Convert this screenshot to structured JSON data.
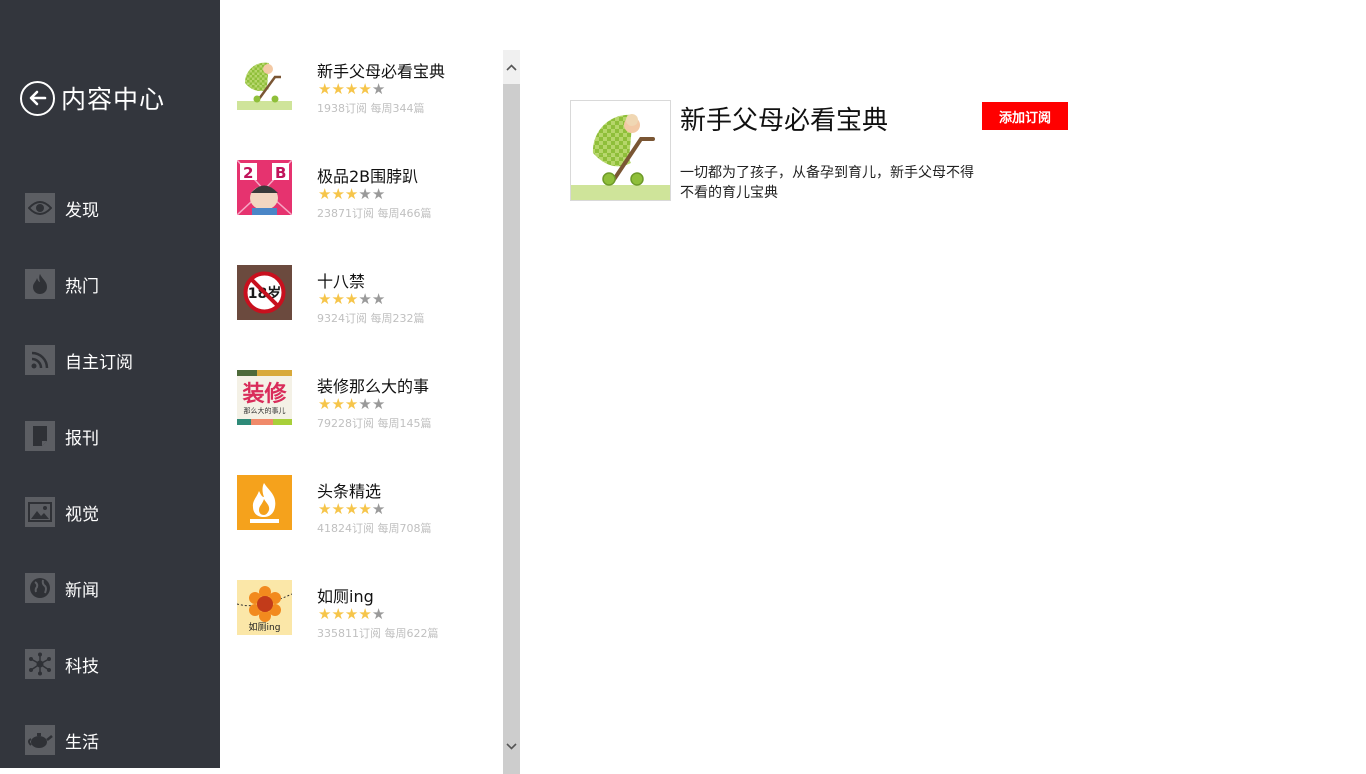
{
  "sidebar": {
    "title": "内容中心",
    "back_icon": "arrow-left-circle-icon",
    "items": [
      {
        "label": "发现",
        "icon": "eye-icon"
      },
      {
        "label": "热门",
        "icon": "flame-icon"
      },
      {
        "label": "自主订阅",
        "icon": "rss-icon"
      },
      {
        "label": "报刊",
        "icon": "document-icon"
      },
      {
        "label": "视觉",
        "icon": "image-icon"
      },
      {
        "label": "新闻",
        "icon": "globe-icon"
      },
      {
        "label": "科技",
        "icon": "network-icon"
      },
      {
        "label": "生活",
        "icon": "teapot-icon"
      }
    ]
  },
  "list": {
    "items": [
      {
        "title": "新手父母必看宝典",
        "rating": 4,
        "max_rating": 5,
        "meta": "1938订阅 每周344篇",
        "thumb": "baby-stroller-icon"
      },
      {
        "title": "极品2B围脖趴",
        "rating": 3,
        "max_rating": 5,
        "meta": "23871订阅 每周466篇",
        "thumb": "cartoon-2b-icon"
      },
      {
        "title": "十八禁",
        "rating": 3,
        "max_rating": 5,
        "meta": "9324订阅 每周232篇",
        "thumb": "no-18-icon",
        "thumb_text": "18岁"
      },
      {
        "title": "装修那么大的事",
        "rating": 3,
        "max_rating": 5,
        "meta": "79228订阅 每周145篇",
        "thumb": "renovation-icon",
        "thumb_text_main": "装修",
        "thumb_text_sub": "那么大的事儿"
      },
      {
        "title": "头条精选",
        "rating": 4,
        "max_rating": 5,
        "meta": "41824订阅 每周708篇",
        "thumb": "fire-icon"
      },
      {
        "title": "如厕ing",
        "rating": 4,
        "max_rating": 5,
        "meta": "335811订阅 每周622篇",
        "thumb": "flower-icon",
        "thumb_text": "如厕ing"
      }
    ]
  },
  "detail": {
    "title": "新手父母必看宝典",
    "subscribe_label": "添加订阅",
    "description": "一切都为了孩子，从备孕到育儿，新手父母不得不看的育儿宝典",
    "thumb": "baby-stroller-icon"
  },
  "colors": {
    "sidebar_bg": "#33363d",
    "accent": "#ff0000",
    "star_on": "#f6c54a",
    "star_off": "#9a9a9a"
  }
}
